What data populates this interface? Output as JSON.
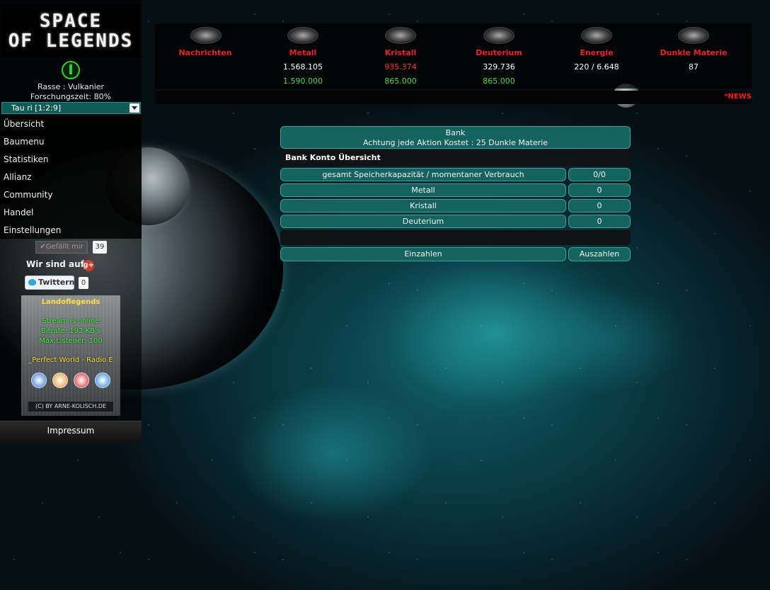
{
  "logo": {
    "line1": "SPACE",
    "line2": "OF LEGENDS"
  },
  "player": {
    "race": "Rasse : Vulkanier",
    "research": "Forschungszeit: 80%"
  },
  "planet_select": {
    "value": "Tau ri [1:2:9]"
  },
  "menu": {
    "items": [
      {
        "label": "Übersicht"
      },
      {
        "label": "Baumenu"
      },
      {
        "label": "Statistiken"
      },
      {
        "label": "Allianz"
      },
      {
        "label": "Community"
      },
      {
        "label": "Handel"
      },
      {
        "label": "Einstellungen"
      }
    ]
  },
  "social": {
    "fb_like_label": "✔Gefällt mir",
    "fb_count": "39",
    "gplus_text": "Wir sind auf",
    "twitter_label": "Twittern",
    "twitter_count": "0"
  },
  "radio": {
    "title": "Landoflegends",
    "status": "Stream is online",
    "bitrate": "Bitrate: 192 KB's",
    "listeners": "Max.Listener: 100",
    "station": "_Perfect World - Radio E",
    "copyright": "(C) BY ARNE-KOLISCH.DE"
  },
  "footer": {
    "label": "Impressum"
  },
  "resources": [
    {
      "label": "Nachrichten",
      "value": "",
      "capacity": "",
      "value_color": "#ffffff",
      "icon": "eye-icon"
    },
    {
      "label": "Metall",
      "value": "1.568.105",
      "capacity": "1.590.000",
      "value_color": "#ffffff",
      "icon": "metal-icon"
    },
    {
      "label": "Kristall",
      "value": "935.374",
      "capacity": "865.000",
      "value_color": "#ff3333",
      "icon": "crystal-icon"
    },
    {
      "label": "Deuterium",
      "value": "329.736",
      "capacity": "865.000",
      "value_color": "#ffffff",
      "icon": "deuterium-icon"
    },
    {
      "label": "Energie",
      "value": "220 / 6.648",
      "capacity": "",
      "value_color": "#ffffff",
      "icon": "energy-icon"
    },
    {
      "label": "Dunkle Materie",
      "value": "87",
      "capacity": "",
      "value_color": "#ffffff",
      "icon": "galaxy-icon"
    }
  ],
  "news": {
    "label": "*NEWS"
  },
  "bank": {
    "title": "Bank",
    "warning": "Achtung jede Aktion Kostet : 25 Dunkle Materie",
    "section_title": "Bank Konto Übersicht",
    "rows": [
      {
        "label": "gesamt Speicherkapazität / momentaner Verbrauch",
        "value": "0/0"
      },
      {
        "label": "Metall",
        "value": "0"
      },
      {
        "label": "Kristall",
        "value": "0"
      },
      {
        "label": "Deuterium",
        "value": "0"
      }
    ],
    "deposit_label": "Einzahlen",
    "withdraw_label": "Auszahlen"
  },
  "colors": {
    "accent": "#14635f",
    "alert": "#ee2222",
    "positive": "#44dd44"
  }
}
